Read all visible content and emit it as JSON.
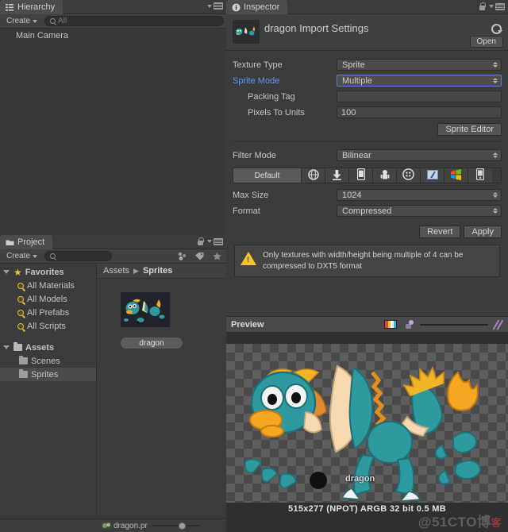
{
  "hierarchy": {
    "tab_label": "Hierarchy",
    "tab_icon": "hierarchy-icon",
    "create_label": "Create",
    "search_placeholder": "All",
    "items": [
      {
        "label": "Main Camera"
      }
    ]
  },
  "project": {
    "tab_label": "Project",
    "tab_icon": "folder-icon",
    "create_label": "Create",
    "search_placeholder": "",
    "breadcrumb": {
      "root": "Assets",
      "separator": "▶",
      "current": "Sprites"
    },
    "favorites": {
      "label": "Favorites",
      "items": [
        "All Materials",
        "All Models",
        "All Prefabs",
        "All Scripts"
      ]
    },
    "assets": {
      "label": "Assets",
      "items": [
        {
          "label": "Scenes",
          "selected": false
        },
        {
          "label": "Sprites",
          "selected": true
        }
      ]
    },
    "grid_items": [
      {
        "label": "dragon"
      }
    ],
    "status_file": "dragon.pr",
    "filter_icons": [
      "type-filter-icon",
      "label-filter-icon",
      "favorite-star-icon"
    ]
  },
  "inspector": {
    "tab_label": "Inspector",
    "tab_icon": "info-icon",
    "title": "dragon Import Settings",
    "open_label": "Open",
    "fields": [
      {
        "label": "Texture Type",
        "value": "Sprite",
        "type": "popup",
        "highlight": false,
        "indent": false,
        "blue": false
      },
      {
        "label": "Sprite Mode",
        "value": "Multiple",
        "type": "popup",
        "highlight": true,
        "indent": false,
        "blue": true
      },
      {
        "label": "Packing Tag",
        "value": "",
        "type": "text",
        "highlight": false,
        "indent": true,
        "blue": false
      },
      {
        "label": "Pixels To Units",
        "value": "100",
        "type": "text",
        "highlight": false,
        "indent": true,
        "blue": false
      }
    ],
    "sprite_editor_label": "Sprite Editor",
    "filter_mode": {
      "label": "Filter Mode",
      "value": "Bilinear"
    },
    "platforms": [
      {
        "label": "Default",
        "icon": "default-tab",
        "selected": true
      },
      {
        "label": "",
        "icon": "web-globe-icon",
        "selected": false
      },
      {
        "label": "",
        "icon": "standalone-download-icon",
        "selected": false
      },
      {
        "label": "",
        "icon": "ios-phone-icon",
        "selected": false
      },
      {
        "label": "",
        "icon": "android-robot-icon",
        "selected": false
      },
      {
        "label": "",
        "icon": "blackberry-icon",
        "selected": false
      },
      {
        "label": "",
        "icon": "flash-icon",
        "selected": false
      },
      {
        "label": "",
        "icon": "windows-store-icon",
        "selected": false
      },
      {
        "label": "",
        "icon": "windows-phone-icon",
        "selected": false
      }
    ],
    "platform_fields": [
      {
        "label": "Max Size",
        "value": "1024"
      },
      {
        "label": "Format",
        "value": "Compressed"
      }
    ],
    "revert_label": "Revert",
    "apply_label": "Apply",
    "warning": {
      "icon": "warning-triangle-icon",
      "text": "Only textures with width/height being multiple of 4 can be compressed to DXT5 format"
    }
  },
  "preview": {
    "title": "Preview",
    "icons": [
      "rgb-channel-icon",
      "mipmap-icon",
      "alpha-icon"
    ],
    "caption": "dragon",
    "status": "515x277 (NPOT)  ARGB 32 bit   0.5 MB",
    "watermark": "@51CTO博",
    "watermark_suffix": "客"
  },
  "colors": {
    "panel_bg": "#383838",
    "chrome_bg": "#3b3b3b",
    "accent_blue": "#5b9bf8",
    "warning_yellow": "#f2c531",
    "dragon_teal": "#2e9aa0",
    "dragon_orange": "#f5a623"
  }
}
